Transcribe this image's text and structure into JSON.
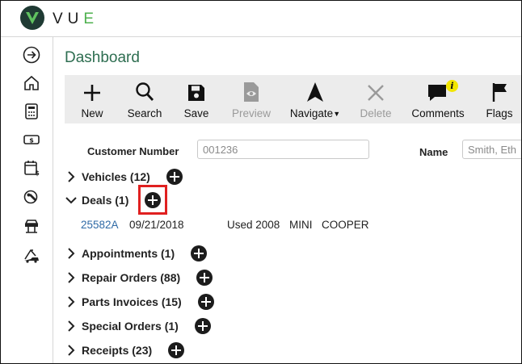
{
  "app": {
    "brand_prefix": "VU",
    "brand_suffix": "E"
  },
  "page": {
    "title": "Dashboard"
  },
  "toolbar": {
    "new": "New",
    "search": "Search",
    "save": "Save",
    "preview": "Preview",
    "navigate": "Navigate",
    "delete": "Delete",
    "comments": "Comments",
    "flags": "Flags",
    "comments_badge": "i"
  },
  "customer": {
    "number_label": "Customer Number",
    "number_value": "001236",
    "name_label": "Name",
    "name_value": "Smith, Eth"
  },
  "sections": {
    "vehicles": "Vehicles (12)",
    "deals": "Deals (1)",
    "appointments": "Appointments (1)",
    "repair_orders": "Repair Orders (88)",
    "parts_invoices": "Parts Invoices (15)",
    "special_orders": "Special Orders (1)",
    "receipts": "Receipts (23)"
  },
  "deal": {
    "id": "25582A",
    "date": "09/21/2018",
    "condition_year": "Used 2008",
    "make": "MINI",
    "model": "COOPER"
  },
  "colors": {
    "accent_green": "#2e6e51",
    "link_blue": "#2f6aa6",
    "highlight_red": "#e02020"
  }
}
